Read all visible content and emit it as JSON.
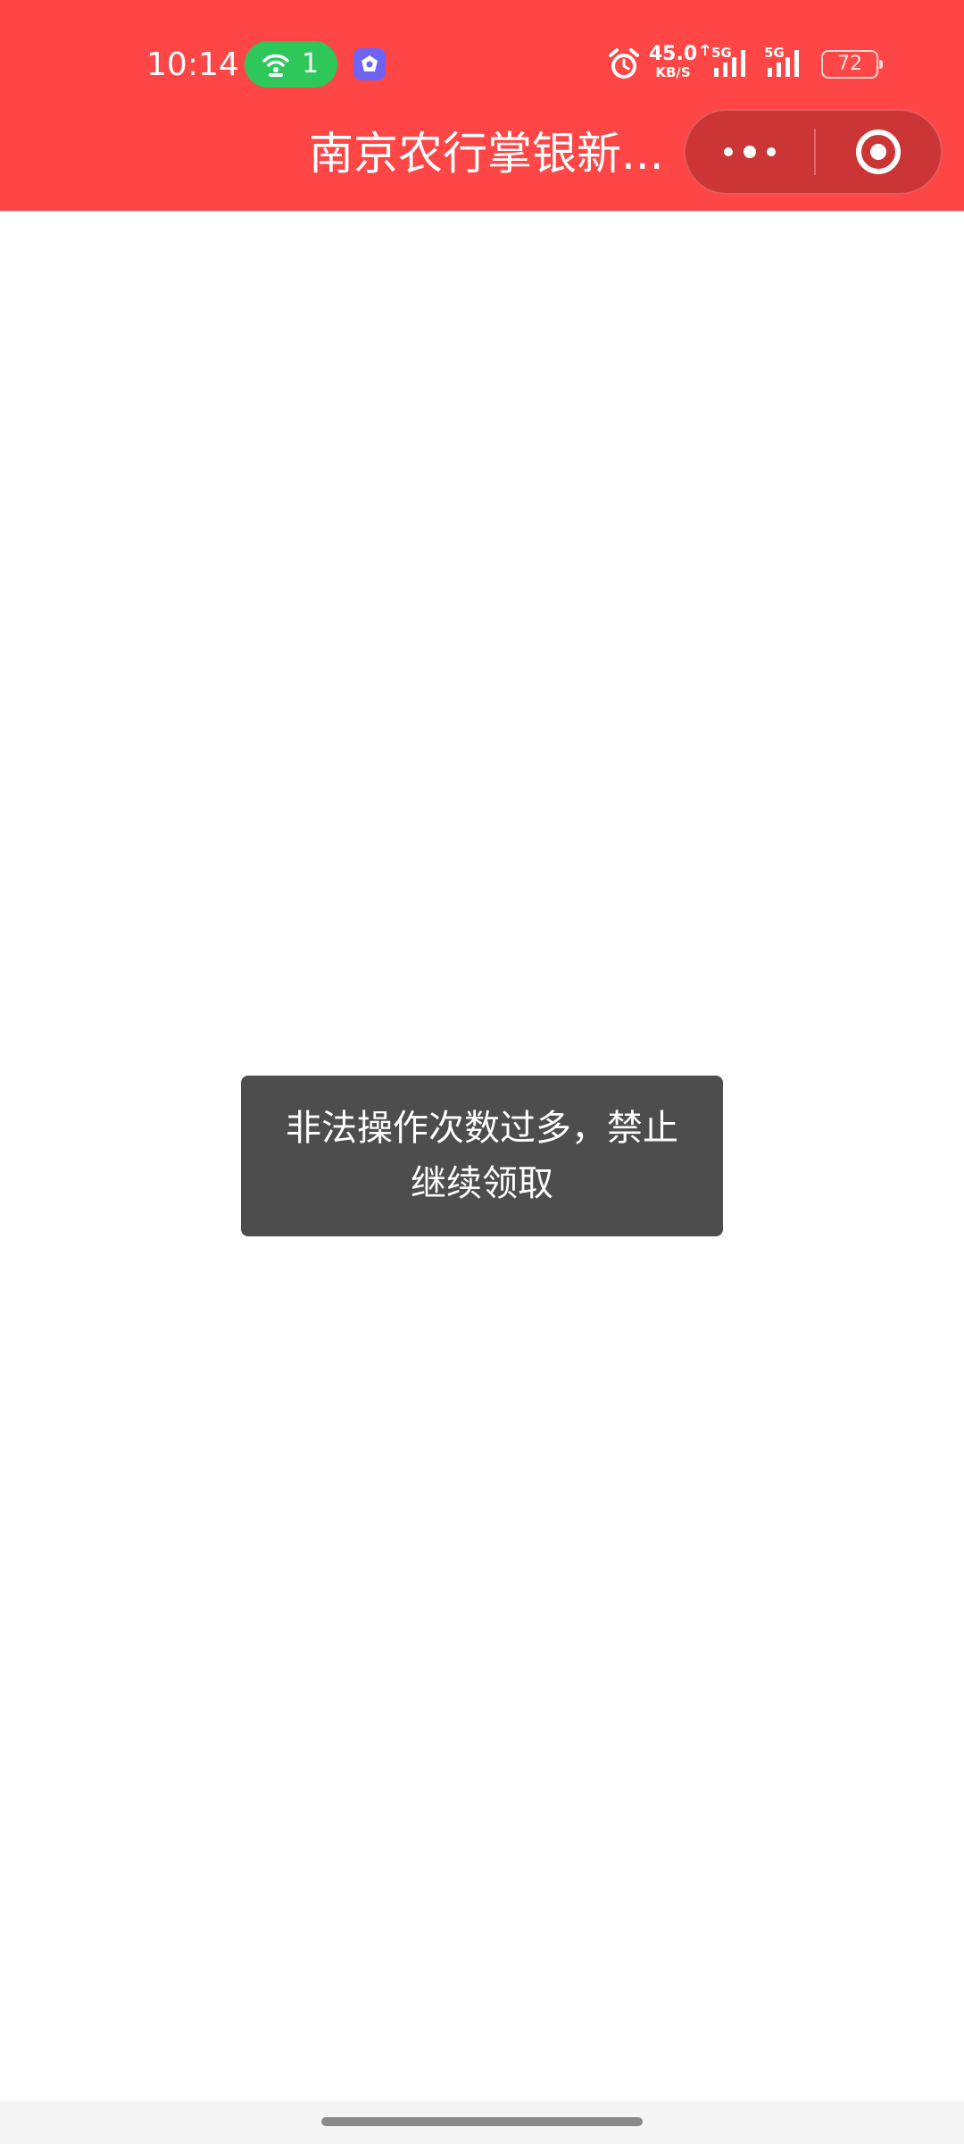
{
  "status_bar": {
    "time": "10:14",
    "hotspot_count": "1",
    "net_speed_value": "45.0",
    "net_speed_unit": "KB/S",
    "signal_1_label": "5G",
    "signal_2_label": "5G",
    "battery_level": "72",
    "icons": [
      "hotspot-icon",
      "app-notification-icon",
      "alarm-icon",
      "signal-icon",
      "battery-icon"
    ]
  },
  "nav": {
    "title": "南京农行掌银新...",
    "more_icon": "more-dots-icon",
    "close_icon": "target-close-icon"
  },
  "toast": {
    "message": "非法操作次数过多，禁止继续领取"
  },
  "colors": {
    "header_bg": "#fe4646",
    "capsule_bg": "#cc3535",
    "toast_bg": "#4d4d4d",
    "page_bg": "#ffffff"
  }
}
